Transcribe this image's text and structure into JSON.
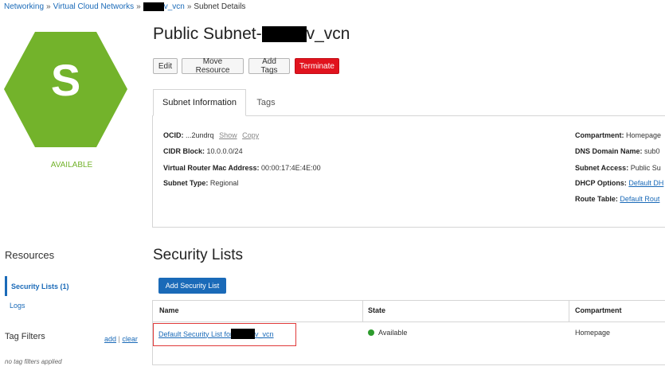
{
  "breadcrumb": {
    "networking": "Networking",
    "sep1": "»",
    "vcns": "Virtual Cloud Networks",
    "sep2": "»",
    "vcn_suffix": "v_vcn",
    "sep3": "»",
    "current": "Subnet Details"
  },
  "resource_icon": {
    "letter": "S",
    "status": "AVAILABLE",
    "color": "#73b32b"
  },
  "title": {
    "prefix": "Public Subnet-",
    "suffix": "v_vcn"
  },
  "actions": {
    "edit": "Edit",
    "move": "Move Resource",
    "add_tags": "Add Tags",
    "terminate": "Terminate"
  },
  "tabs": {
    "subnet_info": "Subnet Information",
    "tags": "Tags"
  },
  "info_left": {
    "ocid_label": "OCID:",
    "ocid_value": "...2undrq",
    "show": "Show",
    "copy": "Copy",
    "cidr_label": "CIDR Block:",
    "cidr_value": "10.0.0.0/24",
    "mac_label": "Virtual Router Mac Address:",
    "mac_value": "00:00:17:4E:4E:00",
    "type_label": "Subnet Type:",
    "type_value": "Regional"
  },
  "info_right": {
    "compartment_label": "Compartment:",
    "compartment_value": "Homepage",
    "dns_label": "DNS Domain Name:",
    "dns_value": "sub0",
    "access_label": "Subnet Access:",
    "access_value": "Public Su",
    "dhcp_label": "DHCP Options:",
    "dhcp_value": "Default DH",
    "route_label": "Route Table:",
    "route_value": "Default Rout"
  },
  "resources": {
    "title": "Resources",
    "security_lists": "Security Lists (1)",
    "logs": "Logs"
  },
  "tag_filters": {
    "title": "Tag Filters",
    "add": "add",
    "sep": "|",
    "clear": "clear",
    "empty": "no tag filters applied"
  },
  "security_lists": {
    "title": "Security Lists",
    "add_button": "Add Security List",
    "headers": {
      "name": "Name",
      "state": "State",
      "compartment": "Compartment"
    },
    "rows": [
      {
        "name_prefix": "Default Security List for",
        "name_suffix": "v_vcn",
        "state": "Available",
        "compartment": "Homepage"
      }
    ]
  }
}
